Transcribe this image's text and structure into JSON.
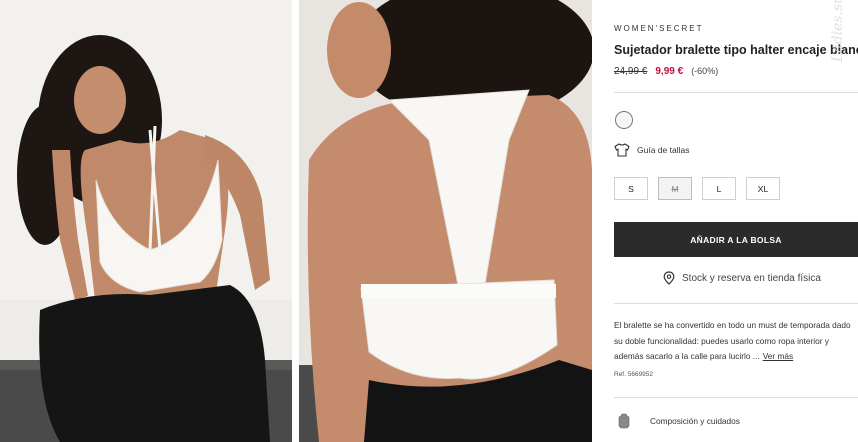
{
  "product": {
    "brand": "WOMEN'SECRET",
    "title": "Sujetador bralette tipo halter encaje blanco",
    "price_old": "24,99 €",
    "price_new": "9,99 €",
    "discount": "(-60%)"
  },
  "colors": {
    "accent_price": "#c0103a",
    "button_bg": "#2b2b2b",
    "swatch": "#f7f6f3"
  },
  "size_guide": {
    "label": "Guía de tallas",
    "icon": "tshirt-icon"
  },
  "sizes": [
    {
      "label": "S",
      "available": true
    },
    {
      "label": "M",
      "available": false
    },
    {
      "label": "L",
      "available": true
    },
    {
      "label": "XL",
      "available": true
    }
  ],
  "add_to_bag": {
    "label": "AÑADIR A LA BOLSA"
  },
  "stock": {
    "label": "Stock y reserva en tienda física",
    "icon": "location-pin-icon"
  },
  "description": {
    "line1": "El bralette se ha convertido en todo un must de temporada dado",
    "line2": "su doble funcionalidad: puedes usarlo como ropa interior y",
    "line3": "además sacarlo a la calle para lucirlo ...",
    "more_link": "Ver más",
    "ref": "Ref. 5669952"
  },
  "composition": {
    "label": "Composición y cuidados",
    "icon": "care-label-icon"
  },
  "watermark": "Ladies.su"
}
